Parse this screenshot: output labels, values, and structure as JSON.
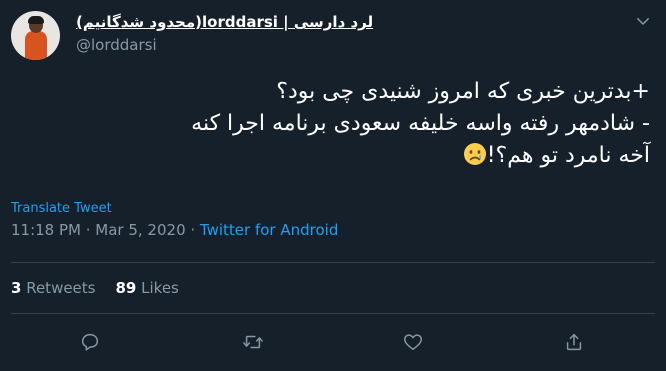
{
  "author": {
    "display_name": "لرد دارسی | lorddarsi(محدود شدگانیم)",
    "handle": "@lorddarsi"
  },
  "tweet": {
    "lines": [
      "+بدترین خبری که امروز شنیدی چی بود؟",
      "- شادمهر رفته واسه خلیفه سعودی برنامه اجرا کنه",
      "آخه نامرد تو هم؟!"
    ],
    "emoji": "crying-face"
  },
  "translate_label": "Translate Tweet",
  "meta": {
    "time_date": "11:18 PM · Mar 5, 2020 · ",
    "source": "Twitter for Android"
  },
  "stats": {
    "retweets_count": "3",
    "retweets_label": " Retweets",
    "likes_count": "89",
    "likes_label": " Likes"
  },
  "colors": {
    "background": "#15202b",
    "text": "#ffffff",
    "secondary": "#8899a6",
    "accent": "#1da1f2",
    "divider": "#38444d"
  },
  "icons": [
    "chevron-down-icon",
    "reply-icon",
    "retweet-icon",
    "like-icon",
    "share-icon",
    "crying-face-emoji"
  ]
}
